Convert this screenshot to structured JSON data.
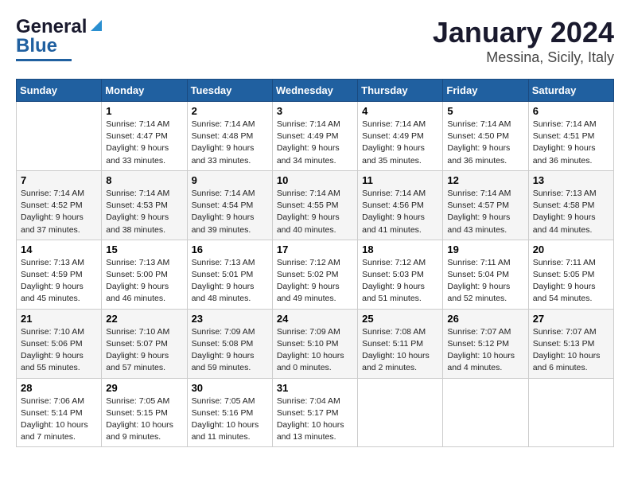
{
  "header": {
    "logo_general": "General",
    "logo_blue": "Blue",
    "title": "January 2024",
    "subtitle": "Messina, Sicily, Italy"
  },
  "weekdays": [
    "Sunday",
    "Monday",
    "Tuesday",
    "Wednesday",
    "Thursday",
    "Friday",
    "Saturday"
  ],
  "weeks": [
    [
      {
        "day": "",
        "info": ""
      },
      {
        "day": "1",
        "info": "Sunrise: 7:14 AM\nSunset: 4:47 PM\nDaylight: 9 hours\nand 33 minutes."
      },
      {
        "day": "2",
        "info": "Sunrise: 7:14 AM\nSunset: 4:48 PM\nDaylight: 9 hours\nand 33 minutes."
      },
      {
        "day": "3",
        "info": "Sunrise: 7:14 AM\nSunset: 4:49 PM\nDaylight: 9 hours\nand 34 minutes."
      },
      {
        "day": "4",
        "info": "Sunrise: 7:14 AM\nSunset: 4:49 PM\nDaylight: 9 hours\nand 35 minutes."
      },
      {
        "day": "5",
        "info": "Sunrise: 7:14 AM\nSunset: 4:50 PM\nDaylight: 9 hours\nand 36 minutes."
      },
      {
        "day": "6",
        "info": "Sunrise: 7:14 AM\nSunset: 4:51 PM\nDaylight: 9 hours\nand 36 minutes."
      }
    ],
    [
      {
        "day": "7",
        "info": "Sunrise: 7:14 AM\nSunset: 4:52 PM\nDaylight: 9 hours\nand 37 minutes."
      },
      {
        "day": "8",
        "info": "Sunrise: 7:14 AM\nSunset: 4:53 PM\nDaylight: 9 hours\nand 38 minutes."
      },
      {
        "day": "9",
        "info": "Sunrise: 7:14 AM\nSunset: 4:54 PM\nDaylight: 9 hours\nand 39 minutes."
      },
      {
        "day": "10",
        "info": "Sunrise: 7:14 AM\nSunset: 4:55 PM\nDaylight: 9 hours\nand 40 minutes."
      },
      {
        "day": "11",
        "info": "Sunrise: 7:14 AM\nSunset: 4:56 PM\nDaylight: 9 hours\nand 41 minutes."
      },
      {
        "day": "12",
        "info": "Sunrise: 7:14 AM\nSunset: 4:57 PM\nDaylight: 9 hours\nand 43 minutes."
      },
      {
        "day": "13",
        "info": "Sunrise: 7:13 AM\nSunset: 4:58 PM\nDaylight: 9 hours\nand 44 minutes."
      }
    ],
    [
      {
        "day": "14",
        "info": "Sunrise: 7:13 AM\nSunset: 4:59 PM\nDaylight: 9 hours\nand 45 minutes."
      },
      {
        "day": "15",
        "info": "Sunrise: 7:13 AM\nSunset: 5:00 PM\nDaylight: 9 hours\nand 46 minutes."
      },
      {
        "day": "16",
        "info": "Sunrise: 7:13 AM\nSunset: 5:01 PM\nDaylight: 9 hours\nand 48 minutes."
      },
      {
        "day": "17",
        "info": "Sunrise: 7:12 AM\nSunset: 5:02 PM\nDaylight: 9 hours\nand 49 minutes."
      },
      {
        "day": "18",
        "info": "Sunrise: 7:12 AM\nSunset: 5:03 PM\nDaylight: 9 hours\nand 51 minutes."
      },
      {
        "day": "19",
        "info": "Sunrise: 7:11 AM\nSunset: 5:04 PM\nDaylight: 9 hours\nand 52 minutes."
      },
      {
        "day": "20",
        "info": "Sunrise: 7:11 AM\nSunset: 5:05 PM\nDaylight: 9 hours\nand 54 minutes."
      }
    ],
    [
      {
        "day": "21",
        "info": "Sunrise: 7:10 AM\nSunset: 5:06 PM\nDaylight: 9 hours\nand 55 minutes."
      },
      {
        "day": "22",
        "info": "Sunrise: 7:10 AM\nSunset: 5:07 PM\nDaylight: 9 hours\nand 57 minutes."
      },
      {
        "day": "23",
        "info": "Sunrise: 7:09 AM\nSunset: 5:08 PM\nDaylight: 9 hours\nand 59 minutes."
      },
      {
        "day": "24",
        "info": "Sunrise: 7:09 AM\nSunset: 5:10 PM\nDaylight: 10 hours\nand 0 minutes."
      },
      {
        "day": "25",
        "info": "Sunrise: 7:08 AM\nSunset: 5:11 PM\nDaylight: 10 hours\nand 2 minutes."
      },
      {
        "day": "26",
        "info": "Sunrise: 7:07 AM\nSunset: 5:12 PM\nDaylight: 10 hours\nand 4 minutes."
      },
      {
        "day": "27",
        "info": "Sunrise: 7:07 AM\nSunset: 5:13 PM\nDaylight: 10 hours\nand 6 minutes."
      }
    ],
    [
      {
        "day": "28",
        "info": "Sunrise: 7:06 AM\nSunset: 5:14 PM\nDaylight: 10 hours\nand 7 minutes."
      },
      {
        "day": "29",
        "info": "Sunrise: 7:05 AM\nSunset: 5:15 PM\nDaylight: 10 hours\nand 9 minutes."
      },
      {
        "day": "30",
        "info": "Sunrise: 7:05 AM\nSunset: 5:16 PM\nDaylight: 10 hours\nand 11 minutes."
      },
      {
        "day": "31",
        "info": "Sunrise: 7:04 AM\nSunset: 5:17 PM\nDaylight: 10 hours\nand 13 minutes."
      },
      {
        "day": "",
        "info": ""
      },
      {
        "day": "",
        "info": ""
      },
      {
        "day": "",
        "info": ""
      }
    ]
  ]
}
